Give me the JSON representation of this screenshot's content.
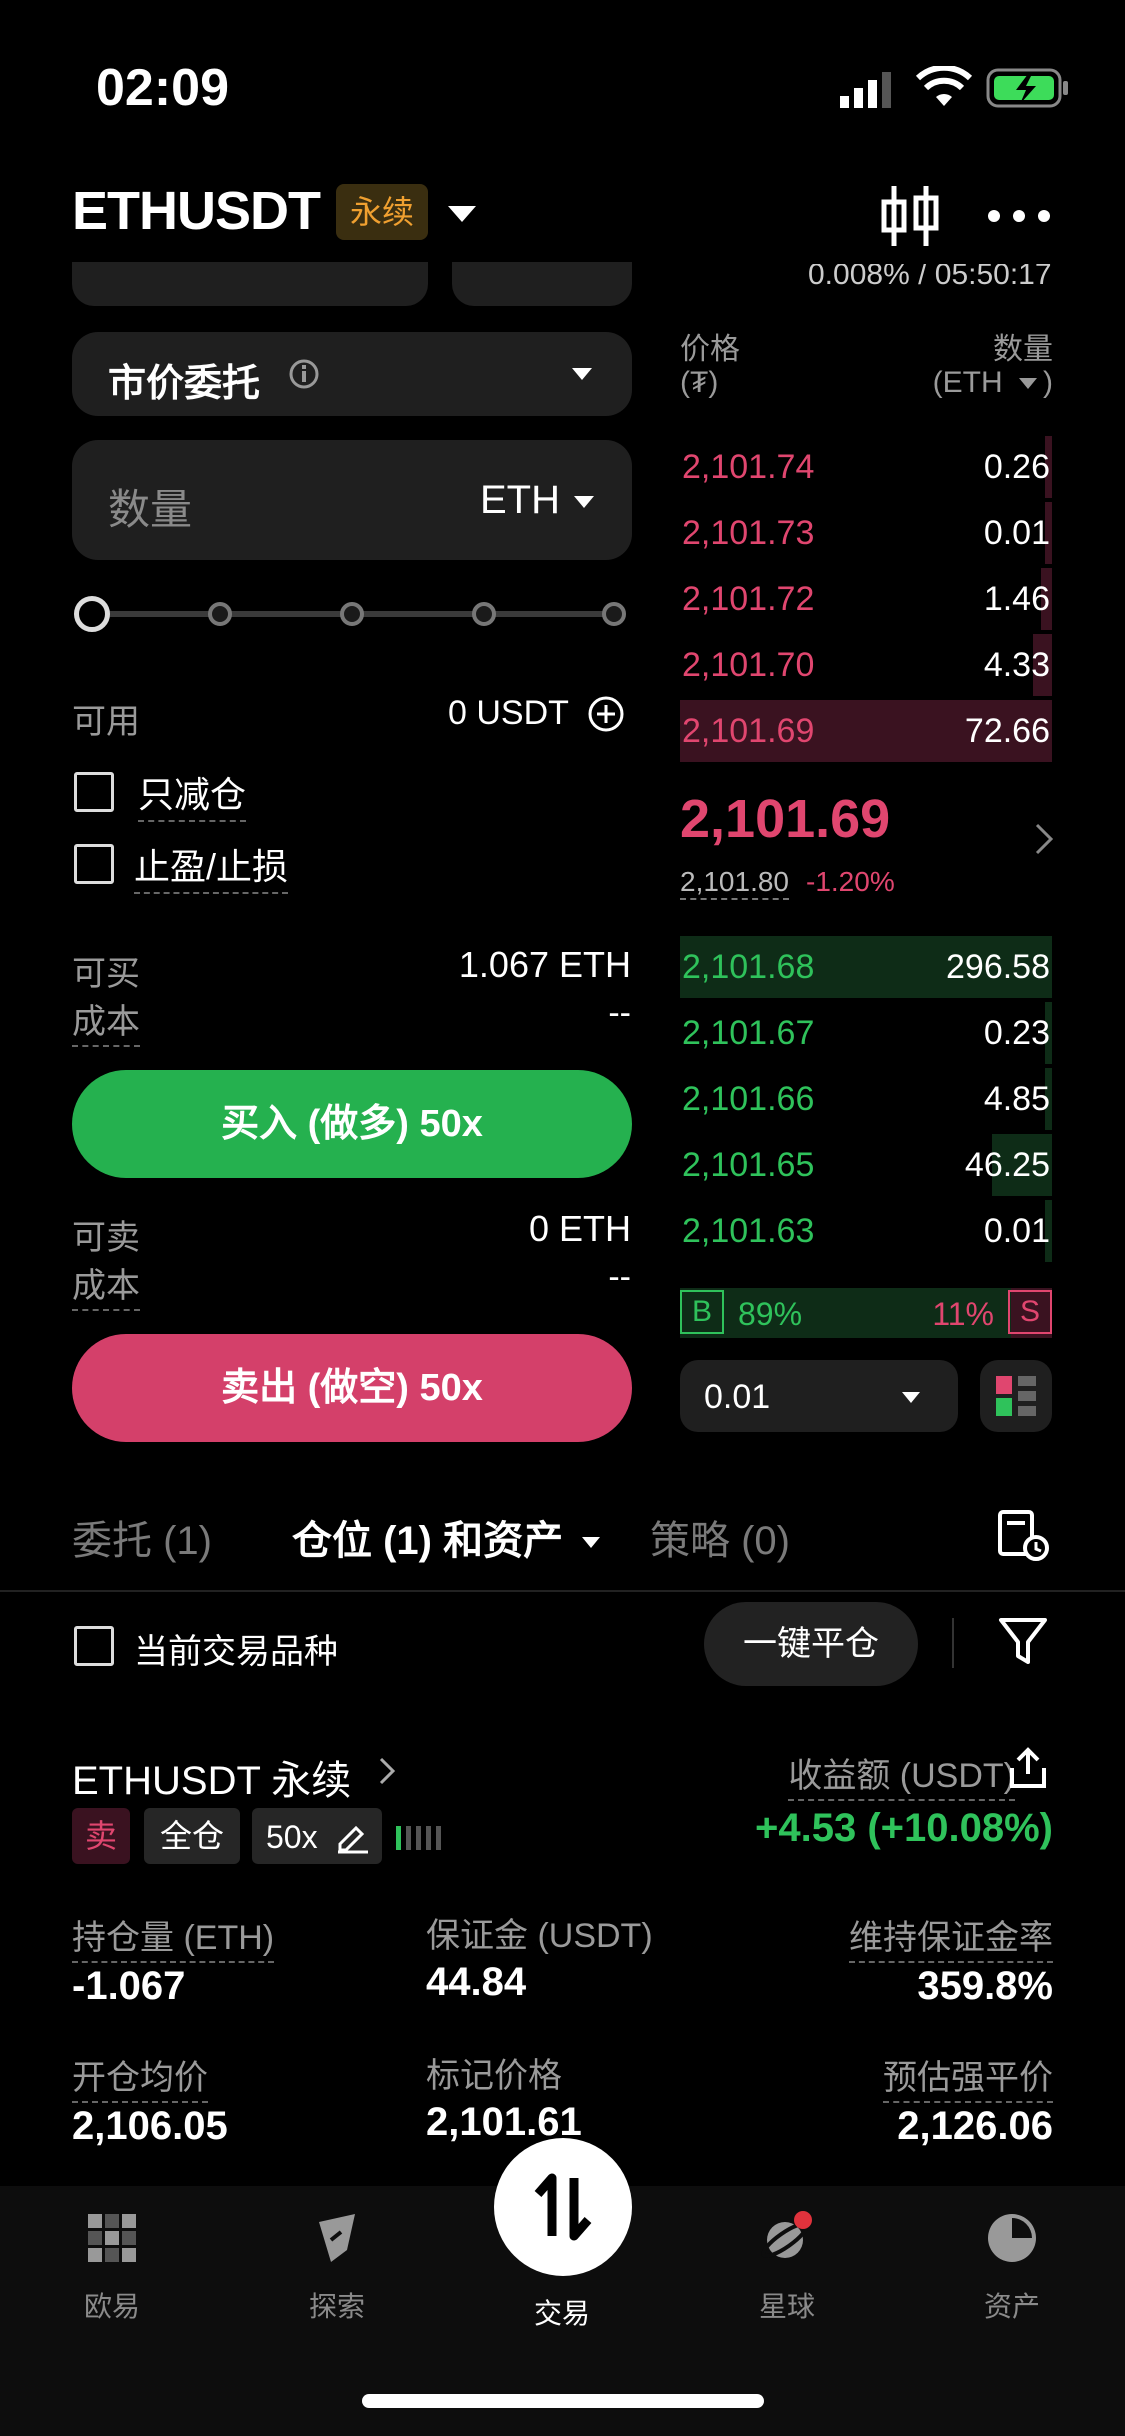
{
  "status": {
    "time": "02:09"
  },
  "header": {
    "pair": "ETHUSDT",
    "badge": "永续"
  },
  "order_form": {
    "clipped_info": "0.008% / 05:50:17",
    "order_type": "市价委托",
    "qty_placeholder": "数量",
    "qty_unit": "ETH",
    "available_label": "可用",
    "available_value": "0 USDT",
    "reduce_only": "只减仓",
    "tp_sl": "止盈/止损",
    "buy_max_label": "可买",
    "buy_max_value": "1.067 ETH",
    "buy_cost_label": "成本",
    "buy_cost_value": "--",
    "buy_button": "买入 (做多) 50x",
    "sell_max_label": "可卖",
    "sell_max_value": "0 ETH",
    "sell_cost_label": "成本",
    "sell_cost_value": "--",
    "sell_button": "卖出 (做空) 50x"
  },
  "orderbook": {
    "price_header": "价格",
    "price_unit": "(₮)",
    "qty_header": "数量",
    "qty_unit": "(ETH",
    "asks": [
      {
        "price": "2,101.74",
        "qty": "0.26",
        "depth": 0.02
      },
      {
        "price": "2,101.73",
        "qty": "0.01",
        "depth": 0.01
      },
      {
        "price": "2,101.72",
        "qty": "1.46",
        "depth": 0.03
      },
      {
        "price": "2,101.70",
        "qty": "4.33",
        "depth": 0.05
      },
      {
        "price": "2,101.69",
        "qty": "72.66",
        "depth": 1.0
      }
    ],
    "last_price": "2,101.69",
    "mark_price": "2,101.80",
    "change": "-1.20%",
    "bids": [
      {
        "price": "2,101.68",
        "qty": "296.58",
        "depth": 1.0
      },
      {
        "price": "2,101.67",
        "qty": "0.23",
        "depth": 0.01
      },
      {
        "price": "2,101.66",
        "qty": "4.85",
        "depth": 0.02
      },
      {
        "price": "2,101.65",
        "qty": "46.25",
        "depth": 0.16
      },
      {
        "price": "2,101.63",
        "qty": "0.01",
        "depth": 0.01
      }
    ],
    "buy_label": "B",
    "buy_pct": "89%",
    "sell_pct": "11%",
    "sell_label": "S",
    "precision": "0.01"
  },
  "tabs": {
    "orders": "委托 (1)",
    "positions": "仓位 (1) 和资产",
    "strategy": "策略 (0)"
  },
  "filter": {
    "current_only": "当前交易品种",
    "close_all": "一键平仓"
  },
  "position": {
    "name": "ETHUSDT 永续",
    "pnl_label": "收益额 (USDT)",
    "pnl_value": "+4.53 (+10.08%)",
    "side": "卖",
    "margin_mode": "全仓",
    "leverage": "50x",
    "size_label": "持仓量 (ETH)",
    "size_value": "-1.067",
    "margin_label": "保证金 (USDT)",
    "margin_value": "44.84",
    "mmr_label": "维持保证金率",
    "mmr_value": "359.8%",
    "entry_label": "开仓均价",
    "entry_value": "2,106.05",
    "mark_label": "标记价格",
    "mark_value": "2,101.61",
    "liq_label": "预估强平价",
    "liq_value": "2,126.06"
  },
  "nav": {
    "home": "欧易",
    "explore": "探索",
    "trade": "交易",
    "planet": "星球",
    "assets": "资产"
  },
  "colors": {
    "buy": "#25b14f",
    "sell": "#d4406a",
    "badge": "#f0a030"
  }
}
